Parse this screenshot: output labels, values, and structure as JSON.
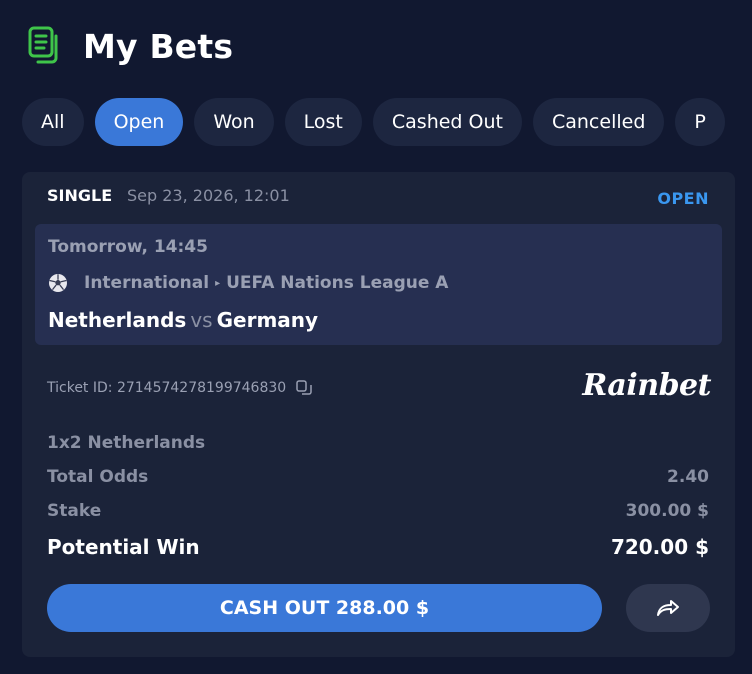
{
  "header": {
    "title": "My Bets",
    "icon": "bets-document-icon",
    "accent": "#3fc54a"
  },
  "filters": [
    {
      "label": "All",
      "active": false
    },
    {
      "label": "Open",
      "active": true
    },
    {
      "label": "Won",
      "active": false
    },
    {
      "label": "Lost",
      "active": false
    },
    {
      "label": "Cashed Out",
      "active": false
    },
    {
      "label": "Cancelled",
      "active": false
    },
    {
      "label": "P",
      "active": false
    }
  ],
  "bet": {
    "type": "SINGLE",
    "date": "Sep 23, 2026, 12:01",
    "status": "OPEN",
    "status_color": "#3a97f0",
    "event": {
      "time": "Tomorrow, 14:45",
      "sport_icon": "soccer-ball-icon",
      "category": "International",
      "league": "UEFA Nations League A",
      "home": "Netherlands",
      "vs": "vs",
      "away": "Germany"
    },
    "ticket_label": "Ticket ID: 2714574278199746830",
    "brand": "Rainbet",
    "selection": "1x2 Netherlands",
    "total_odds_label": "Total Odds",
    "total_odds": "2.40",
    "stake_label": "Stake",
    "stake": "300.00 $",
    "potential_win_label": "Potential Win",
    "potential_win": "720.00 $",
    "cashout_label": "CASH OUT 288.00 $",
    "primary_color": "#3a78d8"
  }
}
